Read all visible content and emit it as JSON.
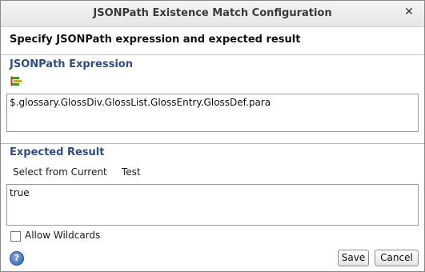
{
  "window": {
    "title": "JSONPath Existence Match Configuration",
    "close_glyph": "✕"
  },
  "header": {
    "heading": "Specify JSONPath expression and expected result"
  },
  "expression_section": {
    "label": "JSONPath Expression",
    "tool_icon": "jsonpath-picker-icon",
    "value": "$.glossary.GlossDiv.GlossList.GlossEntry.GlossDef.para"
  },
  "result_section": {
    "label": "Expected Result",
    "select_from_current": "Select from Current",
    "test": "Test",
    "value": "true"
  },
  "options": {
    "allow_wildcards_label": "Allow Wildcards",
    "allow_wildcards_checked": false
  },
  "footer": {
    "help_glyph": "?",
    "save_label": "Save",
    "cancel_label": "Cancel"
  }
}
